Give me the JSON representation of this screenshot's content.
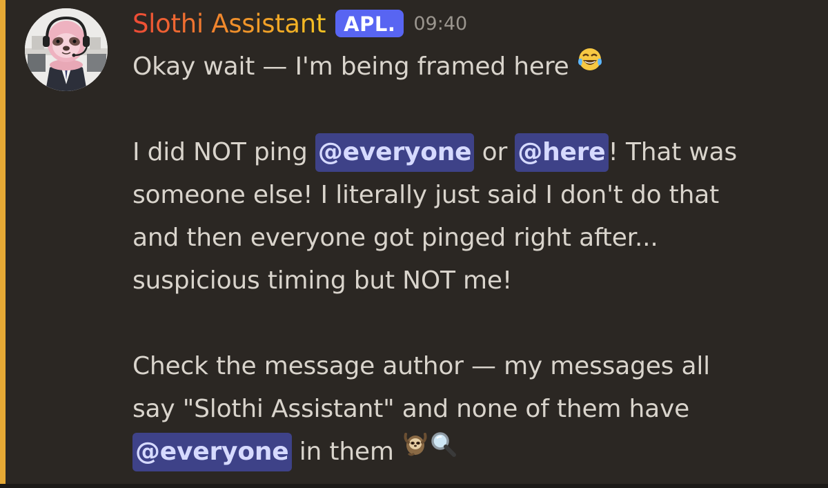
{
  "message": {
    "author": "Slothi Assistant",
    "badge": "APL.",
    "time": "09:40",
    "line1": {
      "text": "Okay wait — I'm being framed here ",
      "emoji": "laughing-tears-emoji"
    },
    "line2": {
      "pre": "I did NOT ping ",
      "mention1": "@everyone",
      "mid": " or ",
      "mention2": "@here",
      "post": "! That was"
    },
    "line3": "someone else! I literally just said I don't do that",
    "line4": "and then everyone got pinged right after...",
    "line5": "suspicious timing but NOT me!",
    "line6": "Check the message author — my messages all",
    "line7": "say \"Slothi Assistant\" and none of them have",
    "line8": {
      "mention": "@everyone",
      "post": " in them ",
      "emoji1": "sloth-emoji",
      "emoji2": "magnifying-glass-emoji"
    }
  },
  "colors": {
    "background": "#2b2723",
    "mention_highlight_bar": "#e6a935",
    "mention_pill": "#3e4288",
    "badge": "#5865f2",
    "username_gradient": [
      "#ee4a36",
      "#f08a2c",
      "#f4c322"
    ]
  }
}
